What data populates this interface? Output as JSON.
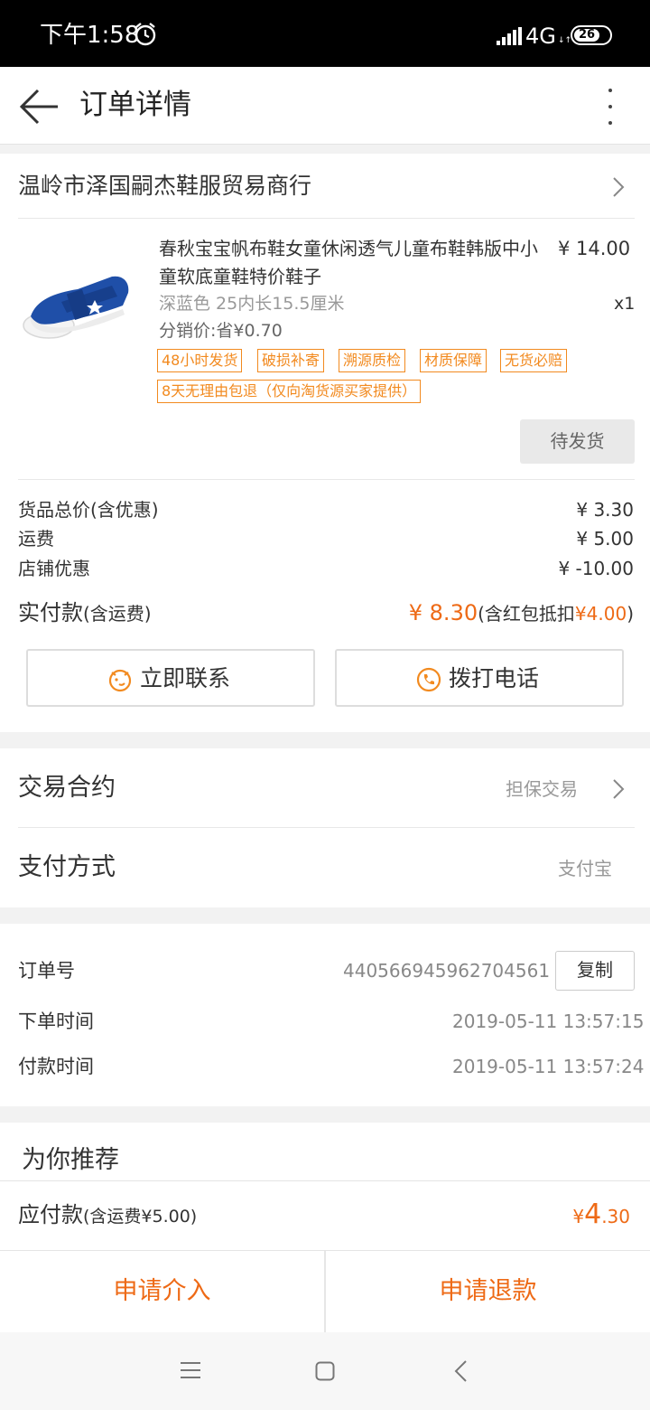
{
  "status_bar": {
    "time": "下午1:58",
    "network": "4G",
    "network_sub": "↓↑",
    "battery": "26"
  },
  "nav": {
    "title": "订单详情"
  },
  "shop": {
    "name": "温岭市泽国嗣杰鞋服贸易商行"
  },
  "product": {
    "title": "春秋宝宝帆布鞋女童休闲透气儿童布鞋韩版中小童软底童鞋特价鞋子",
    "price": "¥ 14.00",
    "spec": "深蓝色 25内长15.5厘米",
    "quantity": "x1",
    "distribution": "分销价:省¥0.70",
    "tags": [
      "48小时发货",
      "破损补寄",
      "溯源质检",
      "材质保障",
      "无货必赔",
      "8天无理由包退（仅向淘货源买家提供）"
    ],
    "status_button": "待发货"
  },
  "summary": {
    "rows": [
      {
        "label": "货品总价(含优惠)",
        "value": "¥ 3.30"
      },
      {
        "label": "运费",
        "value": "¥ 5.00"
      },
      {
        "label": "店铺优惠",
        "value": "¥ -10.00"
      }
    ],
    "paid_label": "实付款",
    "paid_label_note": "(含运费)",
    "paid_amount": "¥ 8.30",
    "paid_note_prefix": "(含红包抵扣",
    "paid_redpacket": "¥4.00",
    "paid_note_suffix": ")"
  },
  "actions": {
    "contact": "立即联系",
    "call": "拨打电话"
  },
  "contract": {
    "label": "交易合约",
    "value": "担保交易"
  },
  "payment": {
    "label": "支付方式",
    "value": "支付宝"
  },
  "order_info": {
    "order_no_label": "订单号",
    "order_no": "440566945962704561",
    "copy_button": "复制",
    "order_time_label": "下单时间",
    "order_time": "2019-05-11 13:57:15",
    "pay_time_label": "付款时间",
    "pay_time": "2019-05-11 13:57:24"
  },
  "recommend": {
    "title": "为你推荐"
  },
  "due": {
    "label": "应付款",
    "note": "(含运费¥5.00)",
    "currency": "¥",
    "integer": "4",
    "decimal": ".30"
  },
  "bottom_actions": {
    "intervene": "申请介入",
    "refund": "申请退款"
  },
  "colors": {
    "accent": "#ee6a16",
    "tag_border": "#f28a1f",
    "status_bar": "#000000",
    "shoe": "#1f4fa8"
  }
}
